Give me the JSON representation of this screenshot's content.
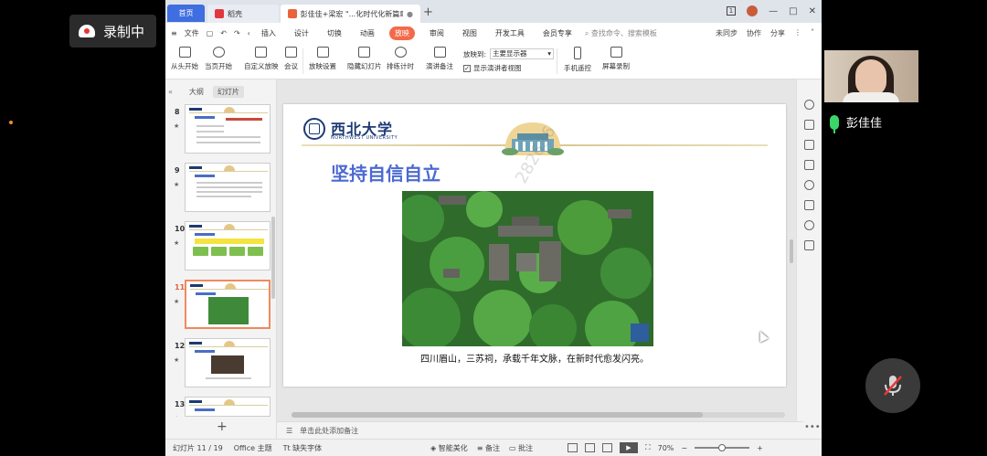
{
  "meeting": {
    "recording_label": "录制中",
    "speaker_name": "彭佳佳"
  },
  "window": {
    "tabs": [
      {
        "label": "首页"
      },
      {
        "label": "稻壳"
      },
      {
        "label": "彭佳佳+梁宏 \"...化时代化新篇章"
      }
    ],
    "controls": [
      "1",
      "—",
      "□",
      "✕"
    ]
  },
  "menu": {
    "file": "文件",
    "items": [
      "插入",
      "设计",
      "切换",
      "动画",
      "放映",
      "审阅",
      "视图",
      "开发工具",
      "会员专享"
    ],
    "active": "放映",
    "search_placeholder": "查找命令、搜索模板",
    "right": [
      "未同步",
      "协作",
      "分享"
    ]
  },
  "ribbon": {
    "buttons": [
      "从头开始",
      "当页开始",
      "自定义放映",
      "会议",
      "放映设置",
      "隐藏幻灯片",
      "排练计时",
      "演讲备注",
      "手机遥控",
      "屏幕录制"
    ],
    "play_to_label": "放映到:",
    "play_to_value": "主要显示器",
    "presenter_view_label": "显示演讲者视图"
  },
  "left_panel": {
    "tabs": [
      "大纲",
      "幻灯片"
    ],
    "active_tab": "幻灯片",
    "slide_numbers": [
      "8",
      "9",
      "10",
      "11",
      "12",
      "13"
    ],
    "selected": "11"
  },
  "slide": {
    "logo_cn": "西北大学",
    "logo_en": "NORTHWEST UNIVERSITY",
    "title": "坚持自信自立",
    "caption": "四川眉山，三苏祠，承载千年文脉，在新时代愈发闪亮。",
    "watermark": "282636"
  },
  "notes": {
    "placeholder": "单击此处添加备注"
  },
  "status": {
    "slide_info": "幻灯片 11 / 19",
    "theme": "Office 主题",
    "missing_font": "缺失字体",
    "smart_beautify": "智能美化",
    "notes": "备注",
    "comments": "批注",
    "zoom": "70%"
  },
  "colors": {
    "accent": "#f26a4a",
    "title_blue": "#4b6ad0",
    "brand_navy": "#1d3a74"
  }
}
